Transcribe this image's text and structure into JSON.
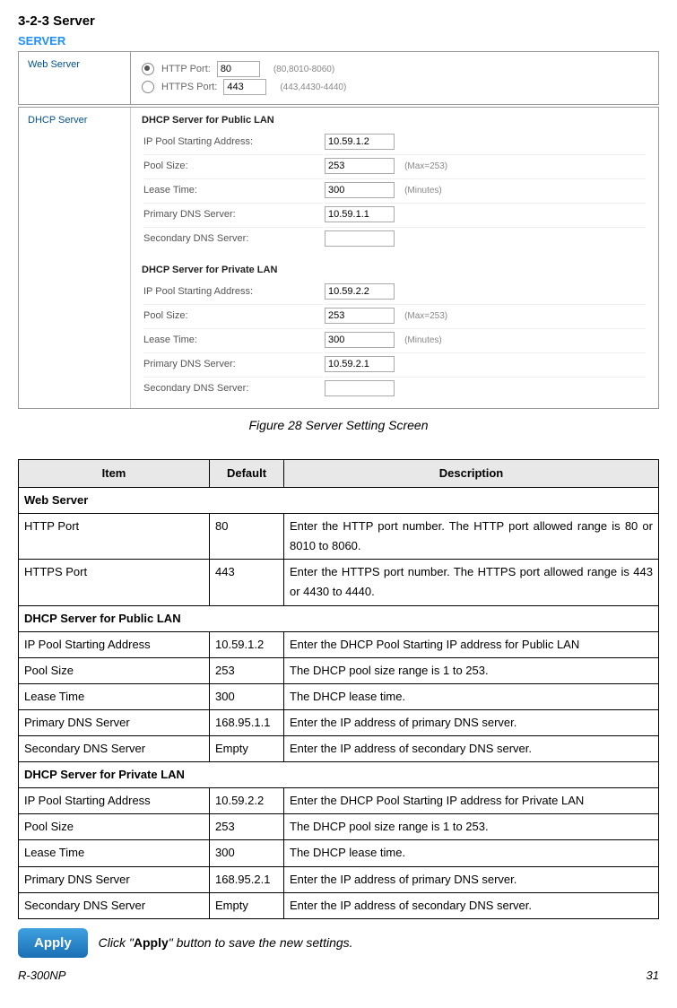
{
  "heading": "3-2-3    Server",
  "server_label": "SERVER",
  "webserver": {
    "title": "Web Server",
    "http_label": "HTTP Port:",
    "http_value": "80",
    "http_hint": "(80,8010-8060)",
    "https_label": "HTTPS Port:",
    "https_value": "443",
    "https_hint": "(443,4430-4440)"
  },
  "dhcp": {
    "title": "DHCP Server",
    "public": {
      "title": "DHCP Server for Public LAN",
      "fields": {
        "ip_label": "IP Pool Starting Address:",
        "ip_value": "10.59.1.2",
        "pool_label": "Pool Size:",
        "pool_value": "253",
        "pool_hint": "(Max=253)",
        "lease_label": "Lease Time:",
        "lease_value": "300",
        "lease_hint": "(Minutes)",
        "primary_label": "Primary DNS Server:",
        "primary_value": "10.59.1.1",
        "secondary_label": "Secondary DNS Server:",
        "secondary_value": ""
      }
    },
    "private": {
      "title": "DHCP Server for Private LAN",
      "fields": {
        "ip_label": "IP Pool Starting Address:",
        "ip_value": "10.59.2.2",
        "pool_label": "Pool Size:",
        "pool_value": "253",
        "pool_hint": "(Max=253)",
        "lease_label": "Lease Time:",
        "lease_value": "300",
        "lease_hint": "(Minutes)",
        "primary_label": "Primary DNS Server:",
        "primary_value": "10.59.2.1",
        "secondary_label": "Secondary DNS Server:",
        "secondary_value": ""
      }
    }
  },
  "caption": "Figure 28 Server Setting Screen",
  "table": {
    "headers": {
      "item": "Item",
      "default": "Default",
      "description": "Description"
    },
    "web_section": "Web Server",
    "rows_web": [
      {
        "item": "HTTP Port",
        "default": "80",
        "desc": "Enter the HTTP port number. The HTTP port allowed range is 80 or 8010 to 8060."
      },
      {
        "item": "HTTPS Port",
        "default": "443",
        "desc": "Enter the HTTPS port number. The HTTPS port allowed range is 443 or 4430 to 4440."
      }
    ],
    "public_section": "DHCP Server for Public LAN",
    "rows_public": [
      {
        "item": "IP Pool Starting Address",
        "default": "10.59.1.2",
        "desc": "Enter the DHCP Pool Starting IP address for Public LAN"
      },
      {
        "item": "Pool Size",
        "default": "253",
        "desc": "The DHCP pool size range is 1 to 253."
      },
      {
        "item": "Lease Time",
        "default": "300",
        "desc": "The DHCP lease time."
      },
      {
        "item": "Primary DNS Server",
        "default": "168.95.1.1",
        "desc": "Enter the IP address of primary DNS server."
      },
      {
        "item": "Secondary DNS Server",
        "default": "Empty",
        "desc": "Enter the IP address of secondary DNS server."
      }
    ],
    "private_section": "DHCP Server for Private LAN",
    "rows_private": [
      {
        "item": "IP Pool Starting Address",
        "default": "10.59.2.2",
        "desc": "Enter the DHCP Pool Starting IP address for Private LAN"
      },
      {
        "item": "Pool Size",
        "default": "253",
        "desc": "The DHCP pool size range is 1 to 253."
      },
      {
        "item": "Lease Time",
        "default": "300",
        "desc": "The DHCP lease time."
      },
      {
        "item": "Primary DNS Server",
        "default": "168.95.2.1",
        "desc": "Enter the IP address of primary DNS server."
      },
      {
        "item": "Secondary DNS Server",
        "default": "Empty",
        "desc": "Enter the IP address of secondary DNS server."
      }
    ]
  },
  "apply": {
    "button": "Apply",
    "text_prefix": "Click \"",
    "text_bold": "Apply",
    "text_suffix": "\" button to save the new settings."
  },
  "footer": {
    "left": "R-300NP",
    "right": "31"
  }
}
